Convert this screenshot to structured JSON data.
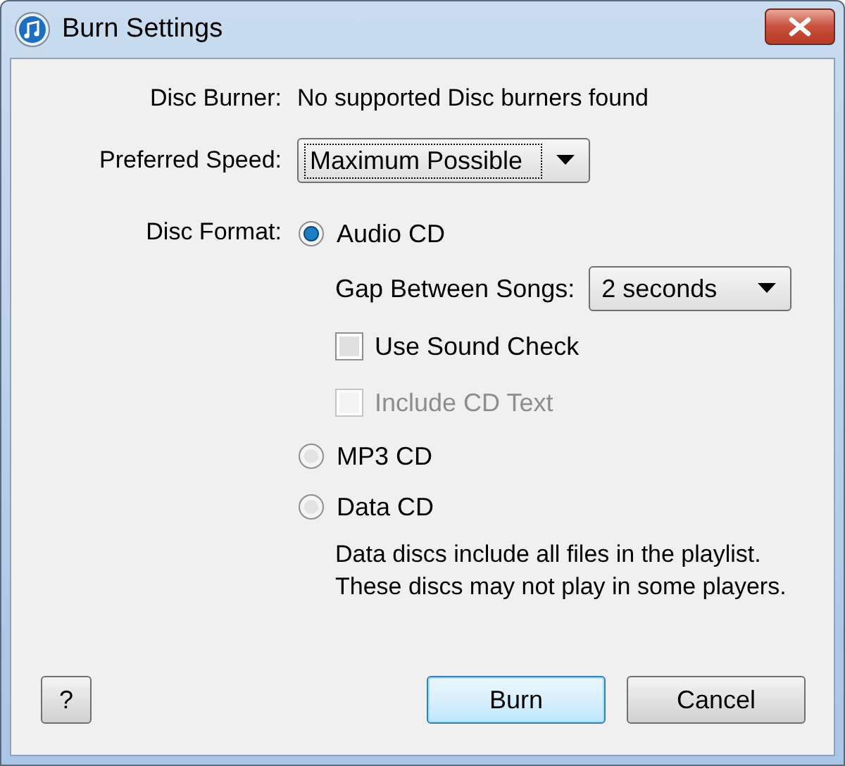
{
  "window": {
    "title": "Burn Settings"
  },
  "disc_burner": {
    "label": "Disc Burner:",
    "value": "No supported Disc burners found"
  },
  "preferred_speed": {
    "label": "Preferred Speed:",
    "value": "Maximum Possible",
    "focused": true
  },
  "disc_format": {
    "label": "Disc Format:",
    "options": [
      {
        "label": "Audio CD",
        "selected": true
      },
      {
        "label": "MP3 CD",
        "selected": false
      },
      {
        "label": "Data CD",
        "selected": false
      }
    ]
  },
  "gap_between_songs": {
    "label": "Gap Between Songs:",
    "value": "2 seconds"
  },
  "checkboxes": [
    {
      "label": "Use Sound Check",
      "checked": false,
      "disabled": false
    },
    {
      "label": "Include CD Text",
      "checked": false,
      "disabled": true
    }
  ],
  "data_note": [
    "Data discs include all files in the playlist.",
    "These discs may not play in some players."
  ],
  "buttons": [
    {
      "label": "?",
      "kind": "help",
      "default": false
    },
    {
      "label": "Burn",
      "kind": "ok",
      "default": true
    },
    {
      "label": "Cancel",
      "kind": "cancel",
      "default": false
    }
  ]
}
